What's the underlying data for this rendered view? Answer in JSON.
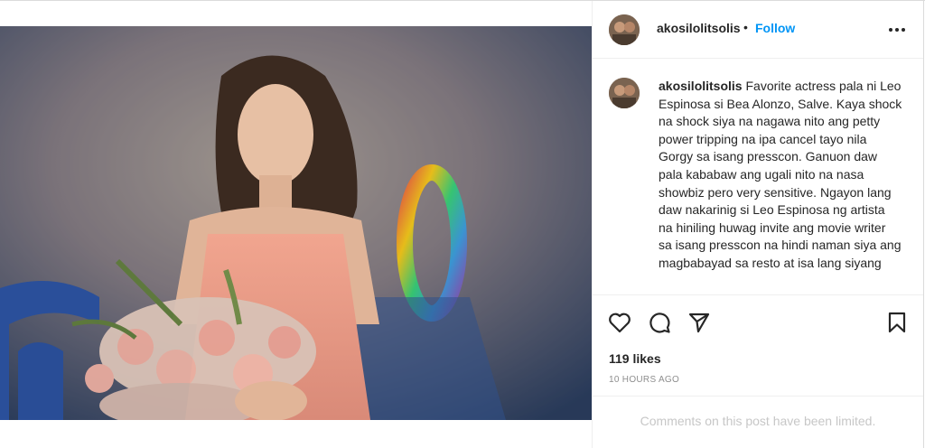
{
  "post": {
    "username": "akosilolitsolis",
    "separator": "•",
    "follow_label": "Follow",
    "caption": "Favorite actress pala ni Leo Espinosa si Bea Alonzo, Salve. Kaya shock na shock siya na nagawa nito ang petty power tripping na ipa cancel tayo nila Gorgy sa isang presscon. Ganuon daw pala kababaw ang ugali nito na nasa showbiz pero very sensitive. Ngayon lang daw nakarinig si Leo Espinosa ng artista na hiniling huwag invite ang movie writer sa isang presscon na hindi naman siya ang magbabayad sa resto at isa lang siyang",
    "likes": "119 likes",
    "time_ago": "10 HOURS AGO",
    "comments_notice": "Comments on this post have been limited."
  },
  "icons": {
    "more": "more-horizontal-icon",
    "like": "heart-icon",
    "comment": "comment-bubble-icon",
    "share": "paper-plane-icon",
    "save": "bookmark-icon"
  },
  "colors": {
    "follow": "#0095f6",
    "text": "#262626",
    "muted": "#8e8e8e",
    "disabled": "#c7c7c7"
  }
}
